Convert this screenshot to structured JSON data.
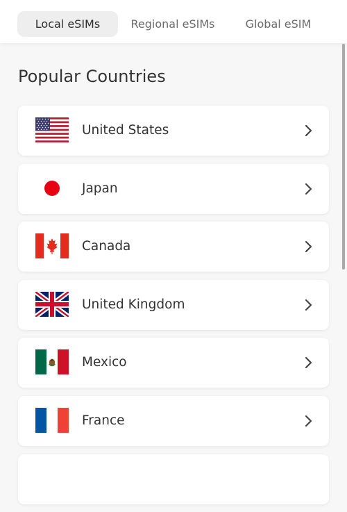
{
  "tabs": [
    {
      "label": "Local eSIMs",
      "active": true
    },
    {
      "label": "Regional eSIMs",
      "active": false
    },
    {
      "label": "Global eSIM",
      "active": false
    }
  ],
  "section": {
    "title": "Popular Countries"
  },
  "countries": [
    {
      "name": "United States",
      "flag_icon": "us-flag-icon"
    },
    {
      "name": "Japan",
      "flag_icon": "japan-flag-icon"
    },
    {
      "name": "Canada",
      "flag_icon": "canada-flag-icon"
    },
    {
      "name": "United Kingdom",
      "flag_icon": "uk-flag-icon"
    },
    {
      "name": "Mexico",
      "flag_icon": "mexico-flag-icon"
    },
    {
      "name": "France",
      "flag_icon": "france-flag-icon"
    },
    {
      "name": "",
      "flag_icon": ""
    }
  ],
  "colors": {
    "background": "#f7f7f7",
    "card": "#ffffff",
    "active_tab": "#eeeeee",
    "text": "#333333",
    "muted_text": "#6b6b6b",
    "scrollbar": "#9c9c9c"
  },
  "icons": {
    "row_arrow": "chevron-right-icon"
  }
}
